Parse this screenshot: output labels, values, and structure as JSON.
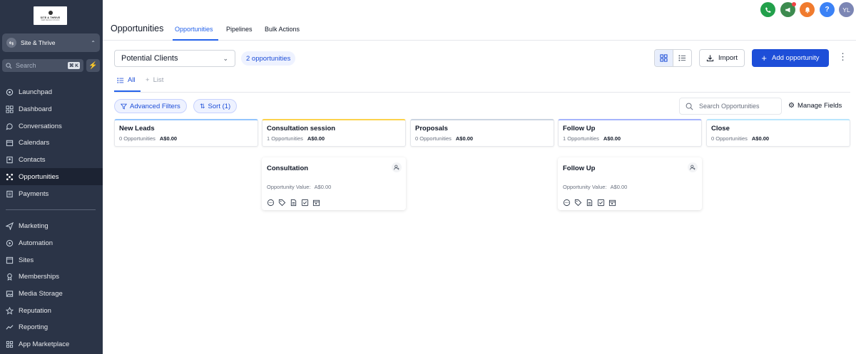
{
  "sidebar": {
    "logo": {
      "line1": "SITE & THRIVE",
      "line2": "WEB DESIGN STUDIO"
    },
    "account": "Site & Thrive",
    "search": {
      "placeholder": "Search",
      "shortcut": "⌘ K"
    },
    "items": [
      {
        "label": "Launchpad",
        "icon": "launchpad-icon"
      },
      {
        "label": "Dashboard",
        "icon": "dashboard-icon"
      },
      {
        "label": "Conversations",
        "icon": "chat-icon"
      },
      {
        "label": "Calendars",
        "icon": "calendar-icon"
      },
      {
        "label": "Contacts",
        "icon": "contacts-icon"
      },
      {
        "label": "Opportunities",
        "icon": "opportunities-icon",
        "active": true
      },
      {
        "label": "Payments",
        "icon": "payments-icon"
      },
      {
        "label": "Marketing",
        "icon": "send-icon"
      },
      {
        "label": "Automation",
        "icon": "automation-icon"
      },
      {
        "label": "Sites",
        "icon": "sites-icon"
      },
      {
        "label": "Memberships",
        "icon": "memberships-icon"
      },
      {
        "label": "Media Storage",
        "icon": "media-icon"
      },
      {
        "label": "Reputation",
        "icon": "star-icon"
      },
      {
        "label": "Reporting",
        "icon": "reporting-icon"
      },
      {
        "label": "App Marketplace",
        "icon": "marketplace-icon"
      }
    ]
  },
  "header": {
    "title": "Opportunities",
    "tabs": [
      "Opportunities",
      "Pipelines",
      "Bulk Actions"
    ],
    "avatar": "YL",
    "colors": {
      "phone": "#22a04b",
      "megaphone": "#3d8b4f",
      "bell": "#f07b2e",
      "help": "#3b82f6",
      "avatar": "#7c86b4"
    }
  },
  "toolbar": {
    "pipeline": "Potential Clients",
    "count": "2 opportunities",
    "import": "Import",
    "add": "Add opportunity"
  },
  "views": {
    "all": "All",
    "list": "List"
  },
  "filters": {
    "advanced": "Advanced Filters",
    "sort": "Sort (1)",
    "search_placeholder": "Search Opportunities",
    "manage": "Manage Fields"
  },
  "stages": [
    {
      "name": "New Leads",
      "count": "0 Opportunities",
      "amount": "A$0.00",
      "color": "#93c5fd"
    },
    {
      "name": "Consultation session",
      "count": "1 Opportunities",
      "amount": "A$0.00",
      "color": "#fcd34d"
    },
    {
      "name": "Proposals",
      "count": "0 Opportunities",
      "amount": "A$0.00",
      "color": "#cbd5e1"
    },
    {
      "name": "Follow Up",
      "count": "1 Opportunities",
      "amount": "A$0.00",
      "color": "#a5b4fc"
    },
    {
      "name": "Close",
      "count": "0 Opportunities",
      "amount": "A$0.00",
      "color": "#bae6fd"
    }
  ],
  "cards": [
    {
      "name": "Consultation",
      "value_label": "Opportunity Value:",
      "value": "A$0.00"
    },
    {
      "name": "Follow Up",
      "value_label": "Opportunity Value:",
      "value": "A$0.00"
    }
  ]
}
